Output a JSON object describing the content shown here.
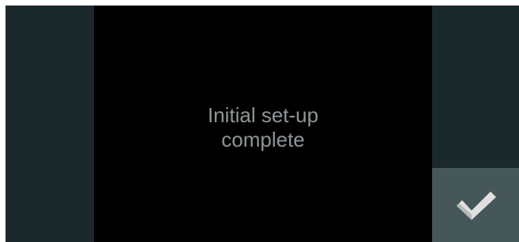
{
  "message": {
    "line1": "Initial set-up",
    "line2": "complete"
  },
  "confirm_button": {
    "icon": "checkmark-icon"
  },
  "colors": {
    "side_panel": "#1b292c",
    "main_panel": "#000000",
    "button": "#46575a",
    "text": "#8e9597",
    "checkmark": "#e0e0e0"
  }
}
